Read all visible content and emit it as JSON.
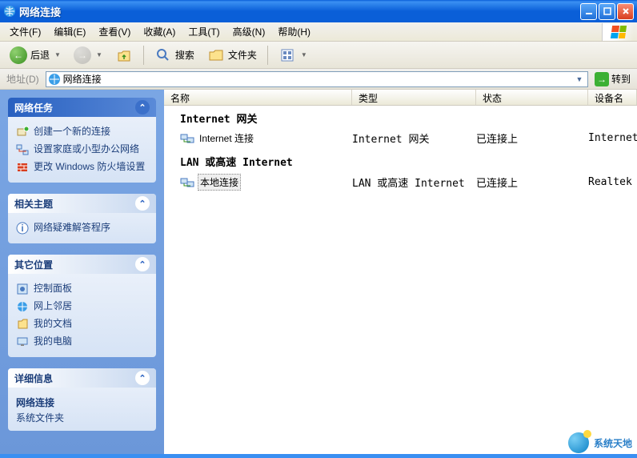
{
  "window": {
    "title": "网络连接"
  },
  "menu": {
    "file": "文件(F)",
    "edit": "编辑(E)",
    "view": "查看(V)",
    "favorites": "收藏(A)",
    "tools": "工具(T)",
    "advanced": "高级(N)",
    "help": "帮助(H)"
  },
  "toolbar": {
    "back": "后退",
    "search": "搜索",
    "folders": "文件夹"
  },
  "address": {
    "label": "地址(D)",
    "value": "网络连接",
    "go": "转到"
  },
  "sidebar": {
    "tasks": {
      "title": "网络任务",
      "items": [
        "创建一个新的连接",
        "设置家庭或小型办公网络",
        "更改 Windows 防火墙设置"
      ]
    },
    "related": {
      "title": "相关主题",
      "items": [
        "网络疑难解答程序"
      ]
    },
    "other": {
      "title": "其它位置",
      "items": [
        "控制面板",
        "网上邻居",
        "我的文档",
        "我的电脑"
      ]
    },
    "details": {
      "title": "详细信息",
      "name": "网络连接",
      "type": "系统文件夹"
    }
  },
  "columns": {
    "name": "名称",
    "type": "类型",
    "status": "状态",
    "devname": "设备名"
  },
  "groups": [
    {
      "header": "Internet 网关",
      "items": [
        {
          "name": "Internet 连接",
          "type": "Internet 网关",
          "status": "已连接上",
          "devname": "Internet"
        }
      ]
    },
    {
      "header": "LAN 或高速 Internet",
      "items": [
        {
          "name": "本地连接",
          "type": "LAN 或高速 Internet",
          "status": "已连接上",
          "devname": "Realtek",
          "selected": true
        }
      ]
    }
  ],
  "watermark": "系统天地"
}
